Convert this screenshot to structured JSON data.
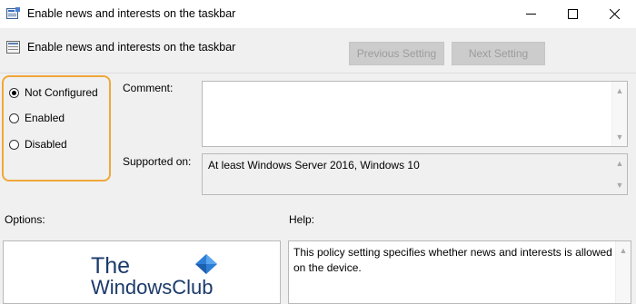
{
  "window": {
    "title": "Enable news and interests on the taskbar"
  },
  "header": {
    "title": "Enable news and interests on the taskbar",
    "previous_label": "Previous Setting",
    "next_label": "Next Setting"
  },
  "options": {
    "not_configured": "Not Configured",
    "enabled": "Enabled",
    "disabled": "Disabled",
    "selected": "Not Configured"
  },
  "comment": {
    "label": "Comment:",
    "value": ""
  },
  "supported": {
    "label": "Supported on:",
    "value": "At least Windows Server 2016, Windows 10"
  },
  "panels": {
    "options_label": "Options:",
    "help_label": "Help:",
    "help_text": "This policy setting specifies whether news and interests is allowed on the device."
  },
  "watermark": {
    "line1": "The",
    "line2": "WindowsClub"
  },
  "colors": {
    "highlight_border": "#f0a73a",
    "disabled_button": "#cccccc"
  }
}
